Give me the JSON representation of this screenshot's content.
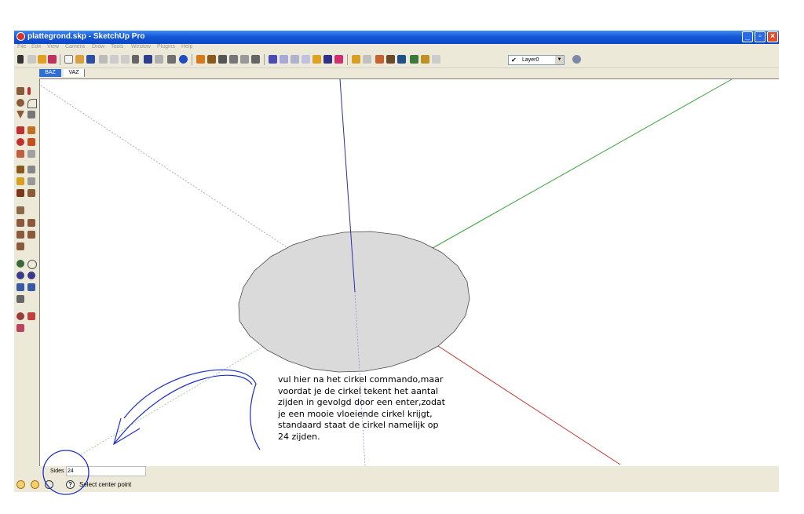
{
  "window": {
    "title": "plattegrond.skp - SketchUp Pro",
    "controls": {
      "minimize": "_",
      "restore": "▫",
      "close": "×"
    }
  },
  "menu": [
    "File",
    "Edit",
    "View",
    "Camera",
    "Draw",
    "Tools",
    "Window",
    "Plugins",
    "Help"
  ],
  "layer": {
    "check": "✔",
    "value": "Layer0",
    "arrow": "▼"
  },
  "scenes": [
    "BAZ",
    "VAZ"
  ],
  "vcb": {
    "label": "Sides",
    "value": "24"
  },
  "status": {
    "help": "?",
    "text": "Select center point"
  },
  "annotation": "vul hier  na het cirkel commando,maar\nvoordat je de cirkel tekent het aantal\nzijden in gevolgd door een enter,zodat\nje een mooie vloeiende cirkel krijgt,\nstandaard staat de cirkel namelijk op\n24 zijden.",
  "colors": {
    "axis_red": "#c23b32",
    "axis_green": "#37a337",
    "axis_blue": "#2b2bb0",
    "face": "#dadada",
    "annotation_pen": "#1e2fc8"
  }
}
